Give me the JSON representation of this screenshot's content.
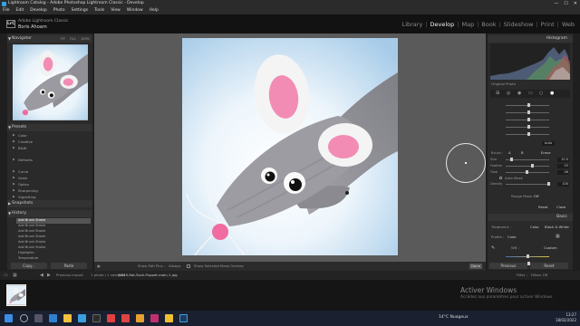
{
  "window": {
    "title": "Lightroom Catalog - Adobe Photoshop Lightroom Classic - Develop",
    "controls": [
      "—",
      "☐",
      "✕"
    ]
  },
  "menu": [
    "File",
    "Edit",
    "Develop",
    "Photo",
    "Settings",
    "Tools",
    "View",
    "Window",
    "Help"
  ],
  "identity": {
    "logo": "LrC",
    "catalog": "Adobe Lightroom Classic",
    "user": "Boris Ahoam"
  },
  "modules": [
    "Library",
    "Develop",
    "Map",
    "Book",
    "Slideshow",
    "Print",
    "Web"
  ],
  "active_module": "Develop",
  "left_panel": {
    "navigator": {
      "title": "Navigator",
      "options": [
        "FIT",
        "FILL",
        "100%"
      ]
    },
    "presets": {
      "title": "Presets",
      "items": [
        "Color",
        "Creative",
        "B&W",
        "Defaults",
        "Curve",
        "Grain",
        "Optics",
        "Sharpening",
        "Vignetting"
      ]
    },
    "snapshots_title": "Snapshots",
    "history": {
      "title": "History",
      "items": [
        "Add Brush Stroke",
        "Add Brush Stroke",
        "Add Brush Stroke",
        "Add Brush Stroke",
        "Add Brush Stroke",
        "Add Brush Stroke",
        "Highlights",
        "Temperature"
      ]
    },
    "copy_label": "Copy...",
    "paste_label": "Paste"
  },
  "toolbar": {
    "show_edit_pins": "Show Edit Pins :",
    "always": "Always",
    "show_overlay": "Show Selected Mask Overlay",
    "done": "Done"
  },
  "right_panel": {
    "histogram_title": "Histogram",
    "original_photo": "Original Photo",
    "amount_label": "Auto",
    "brush": {
      "label": "Brush :",
      "a": "A",
      "b": "B",
      "erase": "Erase",
      "size_label": "Size",
      "size_value": "10.0",
      "feather_label": "Feather",
      "feather_value": "53",
      "flow_label": "Flow",
      "flow_value": "46",
      "auto_mask": "Auto Mask",
      "density_label": "Density",
      "density_value": "100"
    },
    "range_mask_label": "Range Mask :",
    "range_mask_value": "Off",
    "reset_label": "Reset",
    "close_label": "Close",
    "basic_title": "Basic",
    "treatment_label": "Treatment :",
    "color_tab": "Color",
    "bw_tab": "Black & White",
    "profile_label": "Profile :",
    "profile_value": "Color",
    "wb_label": "WB :",
    "wb_value": "Custom",
    "previous_label": "Previous",
    "reset_btn": "Reset"
  },
  "filmstrip": {
    "nav_text": "Previous Import",
    "count_text": "1 photo / 1 selected",
    "filename": "/K849-Rat-Sock-Puppet-main-1.jpg",
    "filter_label": "Filter :",
    "filter_value": "Filters Off"
  },
  "watermark": {
    "line1": "Activer Windows",
    "line2": "Accédez aux paramètres pour activer Windows."
  },
  "taskbar": {
    "weather": "14°C  Nuageux",
    "time": "13:27",
    "date": "18/02/2022"
  }
}
